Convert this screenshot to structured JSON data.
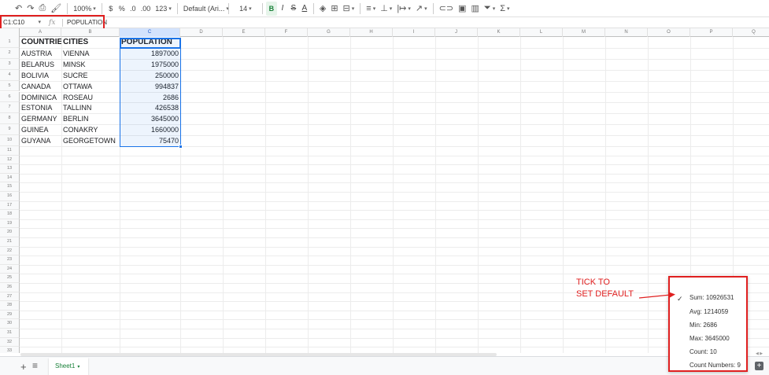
{
  "toolbar": {
    "undo_icon": "undo-icon",
    "redo_icon": "redo-icon",
    "print_icon": "print-icon",
    "paint_format_icon": "paint-format-icon",
    "zoom": "100%",
    "currency": "$",
    "percent": "%",
    "decrease_decimal": ".0",
    "increase_decimal": ".00",
    "more_formats": "123",
    "font": "Default (Ari...",
    "font_size": "14",
    "bold": "B",
    "italic": "I",
    "strike": "S",
    "text_color": "A"
  },
  "formula_bar": {
    "name_box": "C1:C10",
    "fx": "fx",
    "value": "POPULATION"
  },
  "columns": [
    "A",
    "B",
    "C",
    "D",
    "E",
    "F",
    "G",
    "H",
    "I",
    "J",
    "K",
    "L",
    "M",
    "N",
    "O",
    "P",
    "Q"
  ],
  "rows": [
    "1",
    "2",
    "3",
    "4",
    "5",
    "6",
    "7",
    "8",
    "9",
    "10",
    "11",
    "12",
    "13",
    "14",
    "15",
    "16",
    "17",
    "18",
    "19",
    "20",
    "21",
    "22",
    "23",
    "24",
    "25",
    "26",
    "27",
    "28",
    "29",
    "30",
    "31",
    "32",
    "33",
    "34",
    "35"
  ],
  "table": {
    "headers": [
      "COUNTRIES",
      "CITIES",
      "POPULATION"
    ],
    "rows": [
      [
        "AUSTRIA",
        "VIENNA",
        "1897000"
      ],
      [
        "BELARUS",
        "MINSK",
        "1975000"
      ],
      [
        "BOLIVIA",
        "SUCRE",
        "250000"
      ],
      [
        "CANADA",
        "OTTAWA",
        "994837"
      ],
      [
        "DOMINICA",
        "ROSEAU",
        "2686"
      ],
      [
        "ESTONIA",
        "TALLINN",
        "426538"
      ],
      [
        "GERMANY",
        "BERLIN",
        "3645000"
      ],
      [
        "GUINEA",
        "CONAKRY",
        "1660000"
      ],
      [
        "GUYANA",
        "GEORGETOWN",
        "75470"
      ]
    ]
  },
  "sheets": {
    "add": "+",
    "all": "≡",
    "active": "Sheet1"
  },
  "stats": {
    "sum": "Sum: 10926531",
    "avg": "Avg: 1214059",
    "min": "Min: 2686",
    "max": "Max: 3645000",
    "count": "Count: 10",
    "count_numbers": "Count Numbers: 9"
  },
  "annotation": {
    "line1": "TICK TO",
    "line2": "SET DEFAULT"
  },
  "colors": {
    "highlight": "#e02020",
    "selection": "#1a73e8",
    "sheet_tab": "#188038"
  }
}
